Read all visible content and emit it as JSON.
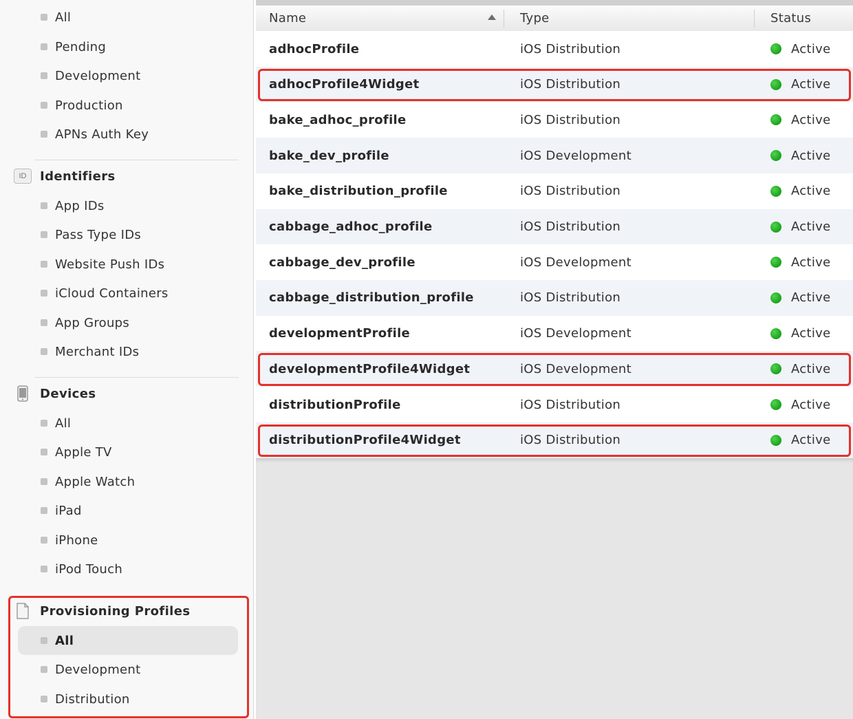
{
  "sidebar": {
    "certificates": {
      "items": [
        {
          "label": "All"
        },
        {
          "label": "Pending"
        },
        {
          "label": "Development"
        },
        {
          "label": "Production"
        },
        {
          "label": "APNs Auth Key"
        }
      ]
    },
    "identifiers": {
      "header": "Identifiers",
      "icon_text": "ID",
      "items": [
        {
          "label": "App IDs"
        },
        {
          "label": "Pass Type IDs"
        },
        {
          "label": "Website Push IDs"
        },
        {
          "label": "iCloud Containers"
        },
        {
          "label": "App Groups"
        },
        {
          "label": "Merchant IDs"
        }
      ]
    },
    "devices": {
      "header": "Devices",
      "items": [
        {
          "label": "All"
        },
        {
          "label": "Apple TV"
        },
        {
          "label": "Apple Watch"
        },
        {
          "label": "iPad"
        },
        {
          "label": "iPhone"
        },
        {
          "label": "iPod Touch"
        }
      ]
    },
    "profiles": {
      "header": "Provisioning Profiles",
      "items": [
        {
          "label": "All",
          "selected": true
        },
        {
          "label": "Development"
        },
        {
          "label": "Distribution"
        }
      ]
    }
  },
  "table": {
    "columns": {
      "name": "Name",
      "type": "Type",
      "status": "Status"
    },
    "sorted_by": "Name",
    "sort_direction": "ascending",
    "status_color": "#22b022",
    "rows": [
      {
        "name": "adhocProfile",
        "type": "iOS Distribution",
        "status": "Active"
      },
      {
        "name": "adhocProfile4Widget",
        "type": "iOS Distribution",
        "status": "Active",
        "highlighted": true
      },
      {
        "name": "bake_adhoc_profile",
        "type": "iOS Distribution",
        "status": "Active"
      },
      {
        "name": "bake_dev_profile",
        "type": "iOS Development",
        "status": "Active"
      },
      {
        "name": "bake_distribution_profile",
        "type": "iOS Distribution",
        "status": "Active"
      },
      {
        "name": "cabbage_adhoc_profile",
        "type": "iOS Distribution",
        "status": "Active"
      },
      {
        "name": "cabbage_dev_profile",
        "type": "iOS Development",
        "status": "Active"
      },
      {
        "name": "cabbage_distribution_profile",
        "type": "iOS Distribution",
        "status": "Active"
      },
      {
        "name": "developmentProfile",
        "type": "iOS Development",
        "status": "Active"
      },
      {
        "name": "developmentProfile4Widget",
        "type": "iOS Development",
        "status": "Active",
        "highlighted": true
      },
      {
        "name": "distributionProfile",
        "type": "iOS Distribution",
        "status": "Active"
      },
      {
        "name": "distributionProfile4Widget",
        "type": "iOS Distribution",
        "status": "Active",
        "highlighted": true
      }
    ]
  },
  "annotation_color": "#e5312a"
}
